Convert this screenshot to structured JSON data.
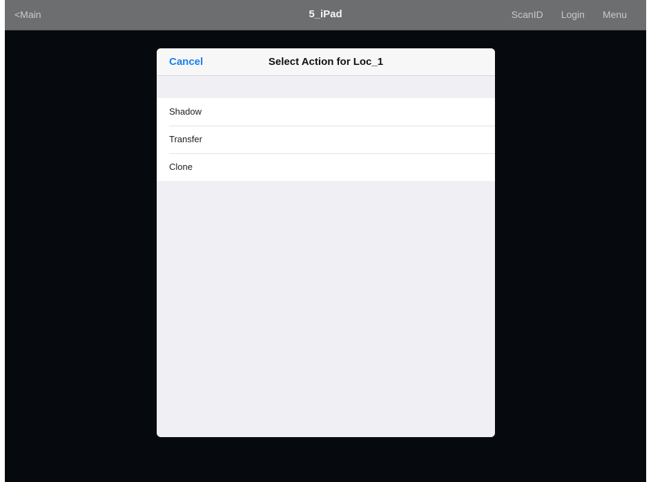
{
  "navbar": {
    "back_label": "<Main",
    "title": "5_iPad",
    "actions": [
      "ScanID",
      "Login",
      "Menu"
    ]
  },
  "modal": {
    "cancel_label": "Cancel",
    "title": "Select Action for Loc_1",
    "items": [
      {
        "label": "Shadow"
      },
      {
        "label": "Transfer"
      },
      {
        "label": "Clone"
      }
    ]
  },
  "colors": {
    "accent": "#1a7ee8",
    "navbar_bg": "#6d6e70",
    "screen_bg": "#06090d",
    "modal_bg": "#efeff4"
  }
}
